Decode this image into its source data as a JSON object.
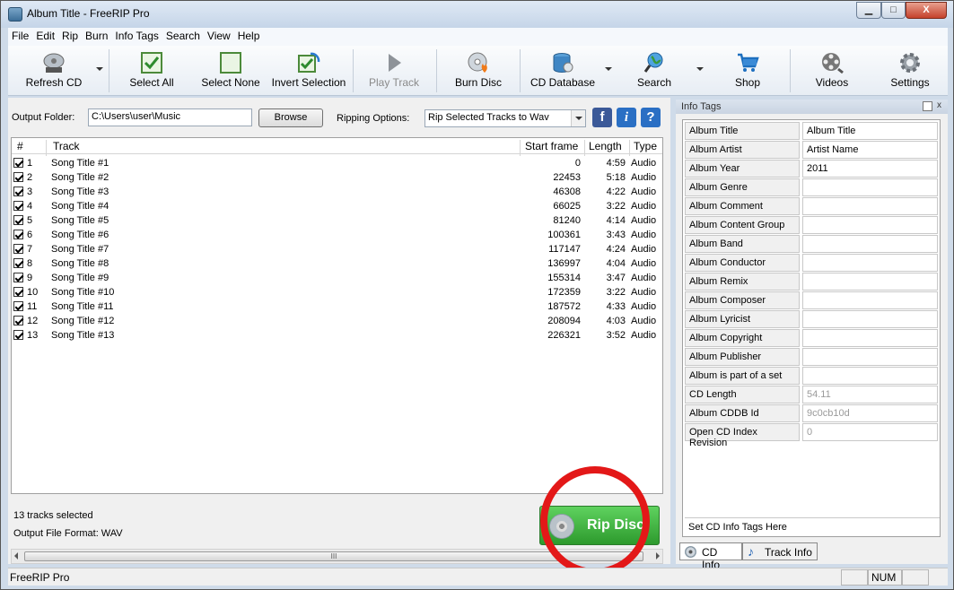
{
  "window": {
    "title": "Album Title - FreeRIP Pro",
    "min_label": "▁",
    "max_label": "□",
    "close_label": "X"
  },
  "menu": [
    "File",
    "Edit",
    "Rip",
    "Burn",
    "Info Tags",
    "Search",
    "View",
    "Help"
  ],
  "toolbar": {
    "refresh": "Refresh CD",
    "select_all": "Select All",
    "select_none": "Select None",
    "invert": "Invert Selection",
    "play": "Play Track",
    "burn": "Burn Disc",
    "cddb": "CD Database",
    "search": "Search",
    "shop": "Shop",
    "videos": "Videos",
    "settings": "Settings"
  },
  "options": {
    "output_label": "Output Folder:",
    "output_value": "C:\\Users\\user\\Music",
    "browse": "Browse",
    "ripping_label": "Ripping Options:",
    "ripping_value": "Rip Selected Tracks to Wav",
    "facebook": "f",
    "info": "i",
    "help": "?"
  },
  "grid": {
    "headers": {
      "num": "#",
      "track": "Track",
      "start": "Start frame",
      "length": "Length",
      "type": "Type"
    },
    "rows": [
      {
        "n": "1",
        "t": "Song Title #1",
        "sf": "0",
        "ln": "4:59",
        "ty": "Audio"
      },
      {
        "n": "2",
        "t": "Song Title #2",
        "sf": "22453",
        "ln": "5:18",
        "ty": "Audio"
      },
      {
        "n": "3",
        "t": "Song Title #3",
        "sf": "46308",
        "ln": "4:22",
        "ty": "Audio"
      },
      {
        "n": "4",
        "t": "Song Title #4",
        "sf": "66025",
        "ln": "3:22",
        "ty": "Audio"
      },
      {
        "n": "5",
        "t": "Song Title #5",
        "sf": "81240",
        "ln": "4:14",
        "ty": "Audio"
      },
      {
        "n": "6",
        "t": "Song Title #6",
        "sf": "100361",
        "ln": "3:43",
        "ty": "Audio"
      },
      {
        "n": "7",
        "t": "Song Title #7",
        "sf": "117147",
        "ln": "4:24",
        "ty": "Audio"
      },
      {
        "n": "8",
        "t": "Song Title #8",
        "sf": "136997",
        "ln": "4:04",
        "ty": "Audio"
      },
      {
        "n": "9",
        "t": "Song Title #9",
        "sf": "155314",
        "ln": "3:47",
        "ty": "Audio"
      },
      {
        "n": "10",
        "t": "Song Title #10",
        "sf": "172359",
        "ln": "3:22",
        "ty": "Audio"
      },
      {
        "n": "11",
        "t": "Song Title #11",
        "sf": "187572",
        "ln": "4:33",
        "ty": "Audio"
      },
      {
        "n": "12",
        "t": "Song Title #12",
        "sf": "208094",
        "ln": "4:03",
        "ty": "Audio"
      },
      {
        "n": "13",
        "t": "Song Title #13",
        "sf": "226321",
        "ln": "3:52",
        "ty": "Audio"
      }
    ]
  },
  "status": {
    "tracks_selected": "13 tracks selected",
    "format": "Output File Format: WAV",
    "rip_disc": "Rip Disc",
    "scroll_grip": "III"
  },
  "info_panel": {
    "title": "Info Tags",
    "tags": [
      {
        "k": "Album Title",
        "v": "Album Title"
      },
      {
        "k": "Album Artist",
        "v": "Artist Name"
      },
      {
        "k": "Album Year",
        "v": "2011"
      },
      {
        "k": "Album Genre",
        "v": ""
      },
      {
        "k": "Album Comment",
        "v": ""
      },
      {
        "k": "Album Content Group",
        "v": ""
      },
      {
        "k": "Album Band",
        "v": ""
      },
      {
        "k": "Album Conductor",
        "v": ""
      },
      {
        "k": "Album Remix",
        "v": ""
      },
      {
        "k": "Album Composer",
        "v": ""
      },
      {
        "k": "Album Lyricist",
        "v": ""
      },
      {
        "k": "Album Copyright",
        "v": ""
      },
      {
        "k": "Album Publisher",
        "v": ""
      },
      {
        "k": "Album is part of a set",
        "v": ""
      },
      {
        "k": "CD Length",
        "v": "54.11"
      },
      {
        "k": "Album CDDB Id",
        "v": "9c0cb10d"
      },
      {
        "k": "Open CD Index Revision",
        "v": "0"
      }
    ],
    "set_info": "Set CD Info Tags Here",
    "tab_cd": "CD Info",
    "tab_track": "Track Info"
  },
  "statusbar": {
    "app": "FreeRIP Pro",
    "num": "NUM"
  }
}
